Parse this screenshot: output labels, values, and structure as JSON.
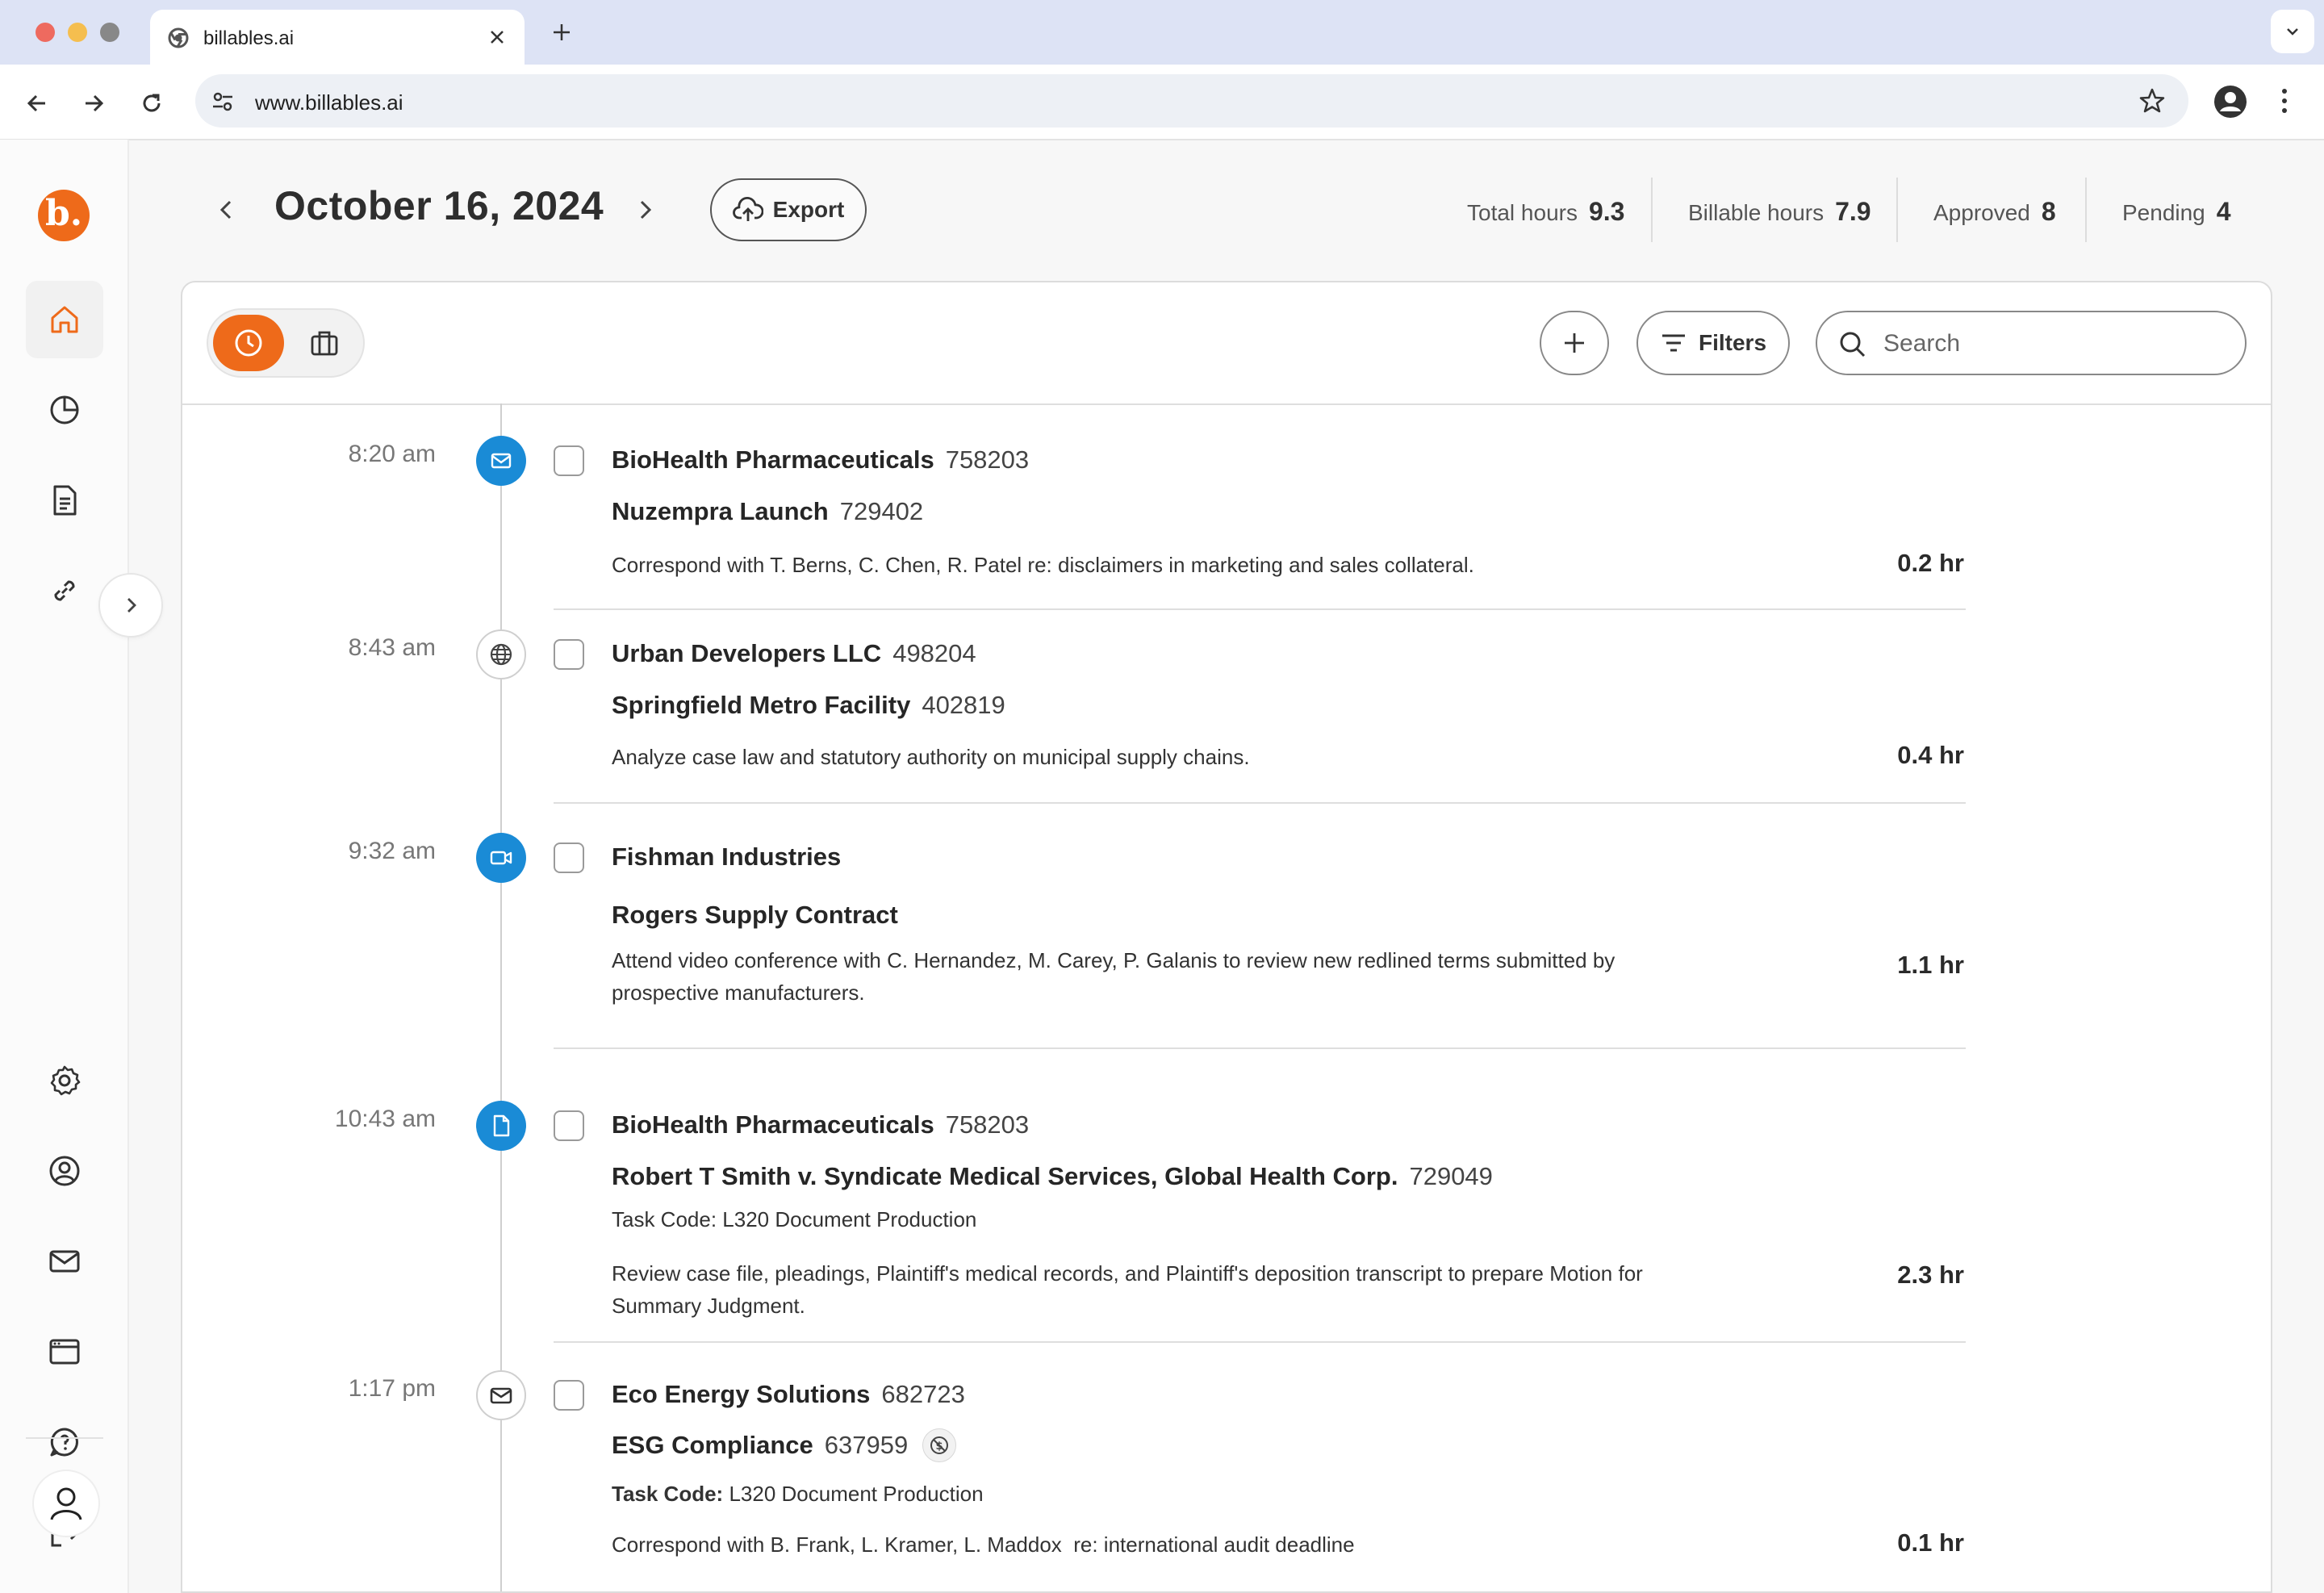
{
  "browser": {
    "tab_title": "billables.ai",
    "url": "www.billables.ai"
  },
  "sidebar": {
    "logo_letter": "b.",
    "items": [
      "home-icon",
      "chart-icon",
      "document-icon",
      "link-icon",
      "gear-icon",
      "user-circle-icon",
      "mail-icon",
      "browser-window-icon",
      "help-icon",
      "logout-icon",
      "profile-icon"
    ]
  },
  "header": {
    "date": "October 16, 2024",
    "export_label": "Export",
    "stats": [
      {
        "label": "Total hours",
        "value": "9.3"
      },
      {
        "label": "Billable hours",
        "value": "7.9"
      },
      {
        "label": "Approved",
        "value": "8"
      },
      {
        "label": "Pending",
        "value": "4"
      }
    ]
  },
  "toolbar": {
    "filters_label": "Filters",
    "search_placeholder": "Search"
  },
  "colors": {
    "accent": "#ee6a1a",
    "timeline_blue": "#1a8bd6"
  },
  "entries": [
    {
      "time": "8:20 am",
      "icon": "email-icon",
      "client": "BioHealth Pharmaceuticals",
      "client_number": "758203",
      "matter": "Nuzempra Launch",
      "matter_number": "729402",
      "description": "Correspond with T. Berns, C. Chen, R. Patel re: disclaimers in marketing and sales collateral.",
      "hours": "0.2 hr"
    },
    {
      "time": "8:43 am",
      "icon": "globe-icon",
      "client": "Urban Developers LLC",
      "client_number": "498204",
      "matter": "Springfield Metro Facility",
      "matter_number": "402819",
      "description": "Analyze case law and statutory authority on municipal supply chains.",
      "hours": "0.4 hr"
    },
    {
      "time": "9:32 am",
      "icon": "video-icon",
      "client": "Fishman Industries",
      "matter": "Rogers Supply Contract",
      "description": "Attend video conference with C. Hernandez, M. Carey, P. Galanis to review new redlined terms submitted by prospective manufacturers.",
      "hours": "1.1 hr"
    },
    {
      "time": "10:43 am",
      "icon": "document-icon",
      "client": "BioHealth Pharmaceuticals",
      "client_number": "758203",
      "matter": "Robert T Smith v. Syndicate Medical Services, Global Health Corp.",
      "matter_number": "729049",
      "task_code": "Task Code: L320 Document Production",
      "description": "Review case file, pleadings, Plaintiff's medical records, and Plaintiff's deposition transcript to prepare Motion for Summary Judgment.",
      "hours": "2.3 hr"
    },
    {
      "time": "1:17 pm",
      "icon": "envelope-icon",
      "client": "Eco Energy Solutions",
      "client_number": "682723",
      "matter": "ESG Compliance",
      "matter_number": "637959",
      "task_code_label": "Task Code:",
      "task_code_value": "L320 Document Production",
      "description": "Correspond with B. Frank, L. Kramer, L. Maddox  re: international audit deadline",
      "hours": "0.1 hr"
    }
  ]
}
